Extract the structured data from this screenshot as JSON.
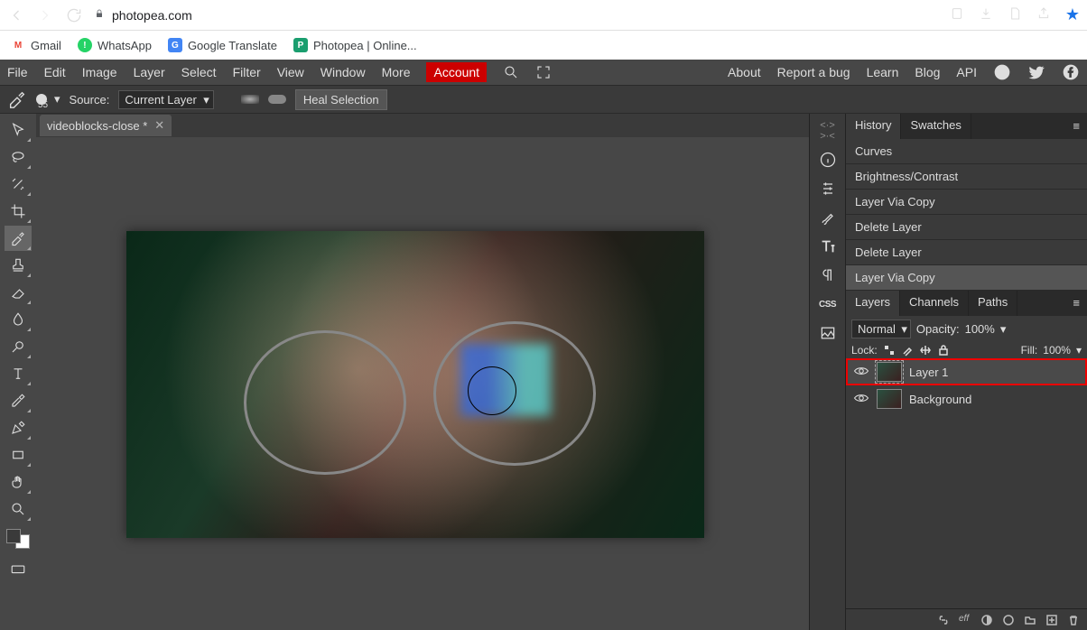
{
  "browser": {
    "url_host": "photopea.com",
    "bookmarks": [
      {
        "label": "Gmail",
        "icon": "gmail"
      },
      {
        "label": "WhatsApp",
        "icon": "whatsapp"
      },
      {
        "label": "Google Translate",
        "icon": "gtranslate"
      },
      {
        "label": "Photopea | Online...",
        "icon": "photopea"
      }
    ]
  },
  "menu": {
    "items": [
      "File",
      "Edit",
      "Image",
      "Layer",
      "Select",
      "Filter",
      "View",
      "Window",
      "More"
    ],
    "account": "Account",
    "right": [
      "About",
      "Report a bug",
      "Learn",
      "Blog",
      "API"
    ]
  },
  "options": {
    "brush_size": "55",
    "source_label": "Source:",
    "source_value": "Current Layer",
    "heal_btn": "Heal Selection"
  },
  "document": {
    "tab_label": "videoblocks-close *"
  },
  "right_icons": [
    "guides",
    "info",
    "adjust",
    "heal-brush",
    "type",
    "paragraph",
    "css",
    "image"
  ],
  "history_panel": {
    "tabs": [
      "History",
      "Swatches"
    ],
    "active_tab": 0,
    "items": [
      "Curves",
      "Brightness/Contrast",
      "Layer Via Copy",
      "Delete Layer",
      "Delete Layer",
      "Layer Via Copy"
    ],
    "current_index": 5
  },
  "layers_panel": {
    "tabs": [
      "Layers",
      "Channels",
      "Paths"
    ],
    "active_tab": 0,
    "blend_mode": "Normal",
    "opacity_label": "Opacity:",
    "opacity_value": "100%",
    "lock_label": "Lock:",
    "fill_label": "Fill:",
    "fill_value": "100%",
    "layers": [
      {
        "name": "Layer 1",
        "selected": true,
        "visible": true
      },
      {
        "name": "Background",
        "selected": false,
        "visible": true
      }
    ]
  }
}
